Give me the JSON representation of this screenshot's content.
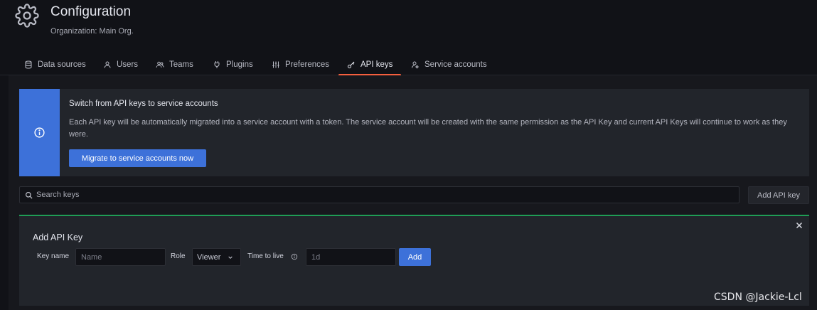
{
  "header": {
    "title": "Configuration",
    "subtitle": "Organization: Main Org."
  },
  "tabs": [
    {
      "label": "Data sources",
      "icon": "database-icon",
      "active": false
    },
    {
      "label": "Users",
      "icon": "user-icon",
      "active": false
    },
    {
      "label": "Teams",
      "icon": "users-icon",
      "active": false
    },
    {
      "label": "Plugins",
      "icon": "plug-icon",
      "active": false
    },
    {
      "label": "Preferences",
      "icon": "sliders-icon",
      "active": false
    },
    {
      "label": "API keys",
      "icon": "key-icon",
      "active": true
    },
    {
      "label": "Service accounts",
      "icon": "user-cog-icon",
      "active": false
    }
  ],
  "alert": {
    "title": "Switch from API keys to service accounts",
    "body": "Each API key will be automatically migrated into a service account with a token. The service account will be created with the same permission as the API Key and current API Keys will continue to work as they were.",
    "button_label": "Migrate to service accounts now"
  },
  "search": {
    "placeholder": "Search keys",
    "value": "",
    "add_button_label": "Add API key"
  },
  "form": {
    "title": "Add API Key",
    "key_name_label": "Key name",
    "key_name_placeholder": "Name",
    "role_label": "Role",
    "role_value": "Viewer",
    "ttl_label": "Time to live",
    "ttl_placeholder": "1d",
    "add_label": "Add"
  },
  "watermark": "CSDN @Jackie-Lcl",
  "colors": {
    "accent_blue": "#3d71d9",
    "active_tab": "#f55f3e",
    "success_border": "#1f9d55",
    "background": "#111217"
  }
}
